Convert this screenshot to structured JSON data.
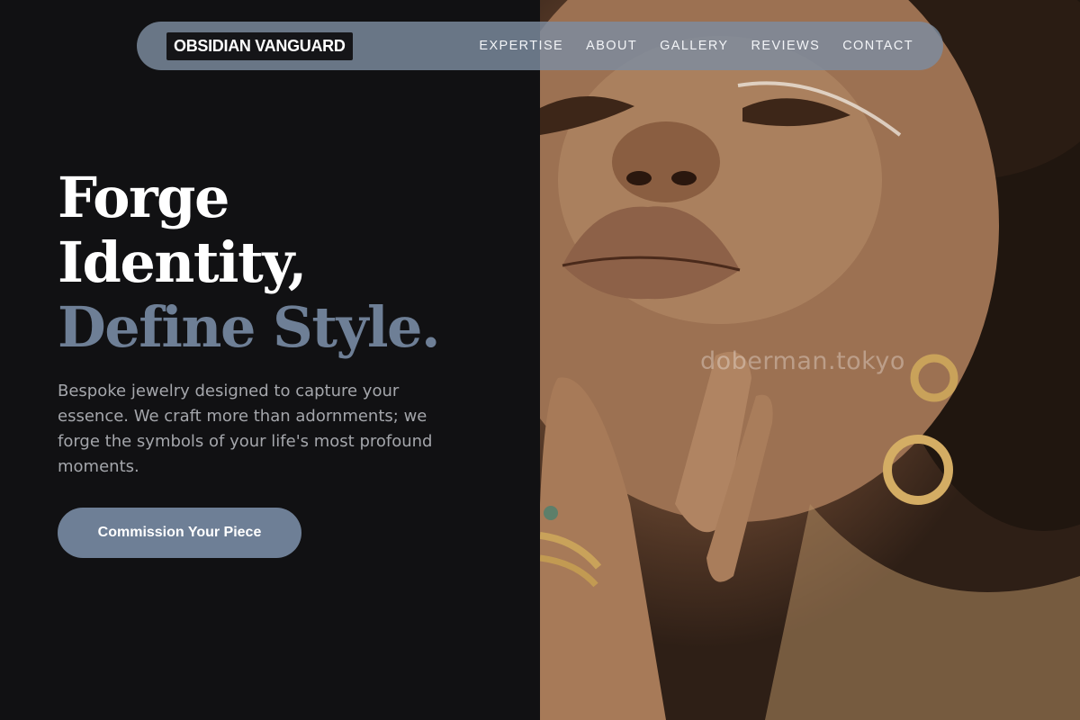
{
  "brand": {
    "logo_text": "OBSIDIAN VANGUARD"
  },
  "nav": {
    "links": [
      {
        "label": "EXPERTISE"
      },
      {
        "label": "ABOUT"
      },
      {
        "label": "GALLERY"
      },
      {
        "label": "REVIEWS"
      },
      {
        "label": "CONTACT"
      }
    ]
  },
  "hero": {
    "headline_line1": "Forge",
    "headline_line2": "Identity,",
    "headline_line3": "Define Style.",
    "description": "Bespoke jewelry designed to capture your essence. We craft more than adornments; we forge the symbols of your life's most profound moments.",
    "cta_label": "Commission Your Piece"
  },
  "photo": {
    "watermark": "doberman.tokyo"
  },
  "colors": {
    "background": "#111113",
    "accent": "#6e7f96",
    "navbar": "#7d8ca0",
    "heading": "#ffffff",
    "body_text": "#a4a6ab"
  }
}
